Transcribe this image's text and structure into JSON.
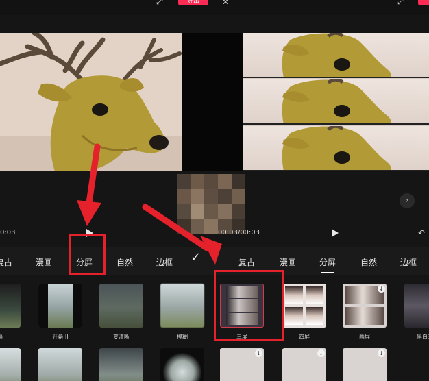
{
  "toolbar": {
    "export_label": "导出"
  },
  "timeline": {
    "left_time": "0:03",
    "right_time": "00:03/00:03"
  },
  "tabs_left": [
    "复古",
    "漫画",
    "分屏",
    "自然",
    "边框"
  ],
  "tabs_right": [
    "复古",
    "漫画",
    "分屏",
    "自然",
    "边框"
  ],
  "tabs_right_active": "分屏",
  "effects_left": [
    {
      "label": "幕"
    },
    {
      "label": "开幕 II"
    },
    {
      "label": "变清晰"
    },
    {
      "label": "模糊"
    }
  ],
  "effects_right": [
    {
      "label": "三屏",
      "selected": true
    },
    {
      "label": "四屏",
      "selected": false
    },
    {
      "label": "两屏",
      "selected": false
    },
    {
      "label": "黑白三",
      "selected": false
    }
  ],
  "colors": {
    "accent_red": "#e5212b",
    "export_pink": "#fe2c55",
    "background": "#151515"
  },
  "icons": [
    "fullscreen-icon",
    "close-icon",
    "play-icon",
    "confirm-check-icon",
    "chevron-right-icon",
    "download-badge-icon",
    "undo-icon"
  ]
}
